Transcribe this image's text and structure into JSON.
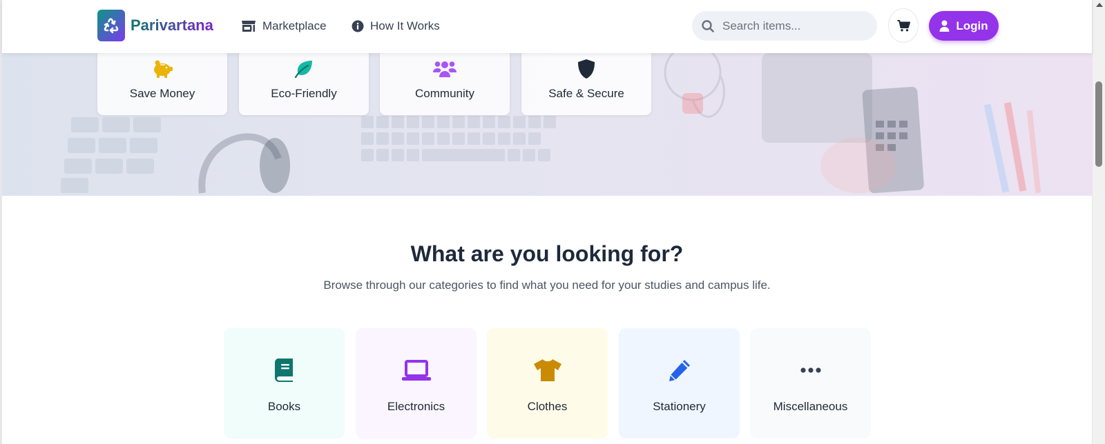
{
  "header": {
    "brand": "Parivartana",
    "nav": [
      {
        "label": "Marketplace",
        "icon": "store-icon"
      },
      {
        "label": "How It Works",
        "icon": "info-circle-icon"
      }
    ],
    "search": {
      "placeholder": "Search items...",
      "value": ""
    },
    "cart_icon": "cart-icon",
    "login_label": "Login"
  },
  "features": [
    {
      "label": "Save Money",
      "icon": "piggy-bank-icon",
      "color": "#eab308"
    },
    {
      "label": "Eco-Friendly",
      "icon": "leaf-icon",
      "color": "#14b8a6"
    },
    {
      "label": "Community",
      "icon": "users-icon",
      "color": "#a855f7"
    },
    {
      "label": "Safe & Secure",
      "icon": "shield-icon",
      "color": "#1f2937"
    }
  ],
  "categories_section": {
    "title": "What are you looking for?",
    "subtitle": "Browse through our categories to find what you need for your studies and campus life.",
    "items": [
      {
        "label": "Books",
        "icon": "book-icon",
        "color": "#0f766e",
        "bg": "#f0fdfa"
      },
      {
        "label": "Electronics",
        "icon": "laptop-icon",
        "color": "#9333ea",
        "bg": "#faf5ff"
      },
      {
        "label": "Clothes",
        "icon": "shirt-icon",
        "color": "#ca8a04",
        "bg": "#fefce8"
      },
      {
        "label": "Stationery",
        "icon": "pencil-icon",
        "color": "#2563eb",
        "bg": "#eff6ff"
      },
      {
        "label": "Miscellaneous",
        "icon": "ellipsis-icon",
        "color": "#374151",
        "bg": "#f9fafb"
      }
    ]
  },
  "colors": {
    "brand_teal": "#0d9488",
    "brand_purple": "#9333ea"
  }
}
